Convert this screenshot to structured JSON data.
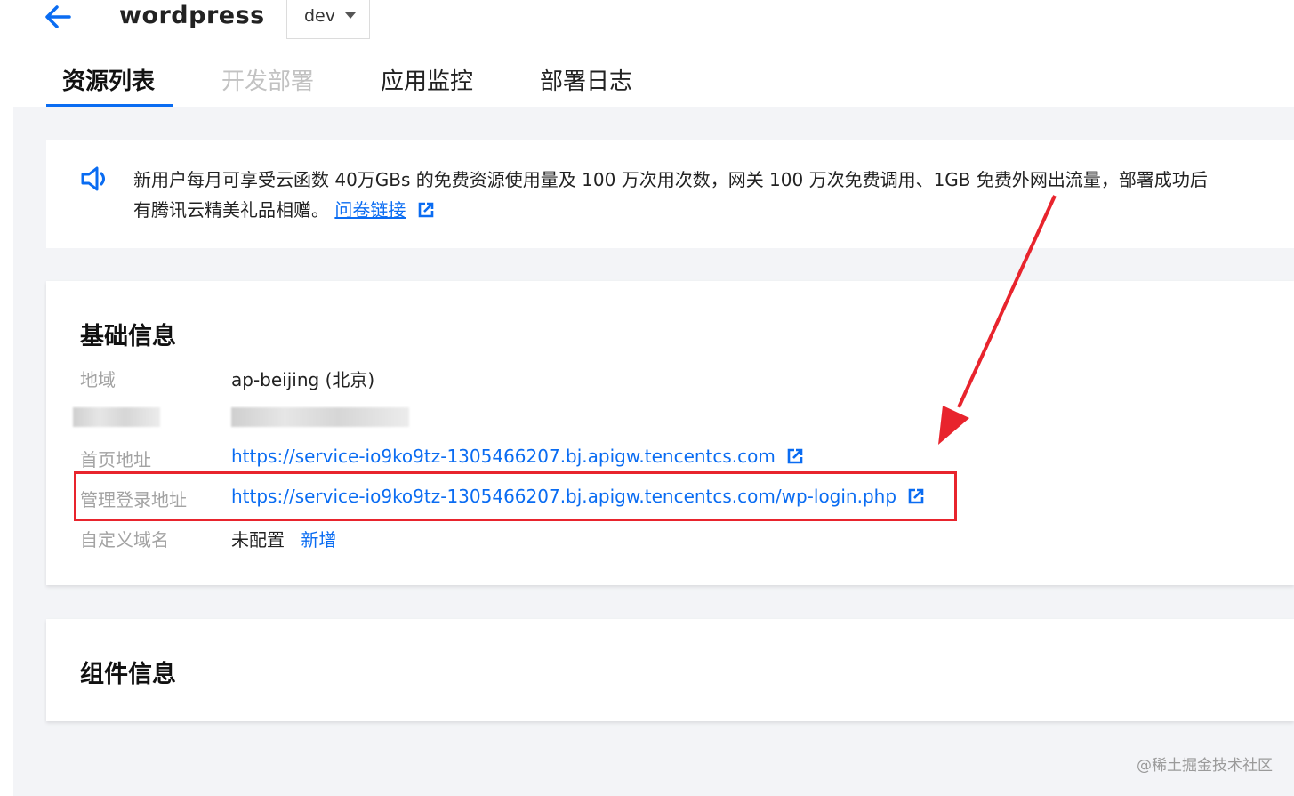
{
  "header": {
    "app_title": "wordpress",
    "env_select": {
      "value": "dev"
    }
  },
  "tabs": [
    {
      "label": "资源列表",
      "state": "active"
    },
    {
      "label": "开发部署",
      "state": "disabled"
    },
    {
      "label": "应用监控",
      "state": "normal"
    },
    {
      "label": "部署日志",
      "state": "normal"
    }
  ],
  "notice": {
    "line1": "新用户每月可享受云函数 40万GBs 的免费资源使用量及 100 万次用次数，网关 100 万次免费调用、1GB 免费外网出流量，部署成功后",
    "line2_prefix": "有腾讯云精美礼品相赠。",
    "survey_link": "问卷链接"
  },
  "basic_info": {
    "title": "基础信息",
    "region_label": "地域",
    "region_value": "ap-beijing (北京)",
    "homepage_label": "首页地址",
    "homepage_url": "https://service-io9ko9tz-1305466207.bj.apigw.tencentcs.com",
    "admin_label": "管理登录地址",
    "admin_url": "https://service-io9ko9tz-1305466207.bj.apigw.tencentcs.com/wp-login.php",
    "domain_label": "自定义域名",
    "domain_value": "未配置",
    "domain_add": "新增"
  },
  "component_info": {
    "title": "组件信息"
  },
  "watermark": "@稀土掘金技术社区",
  "colors": {
    "accent": "#0a6cf2",
    "highlight": "#e8242d",
    "page_bg": "#f3f4f7"
  }
}
